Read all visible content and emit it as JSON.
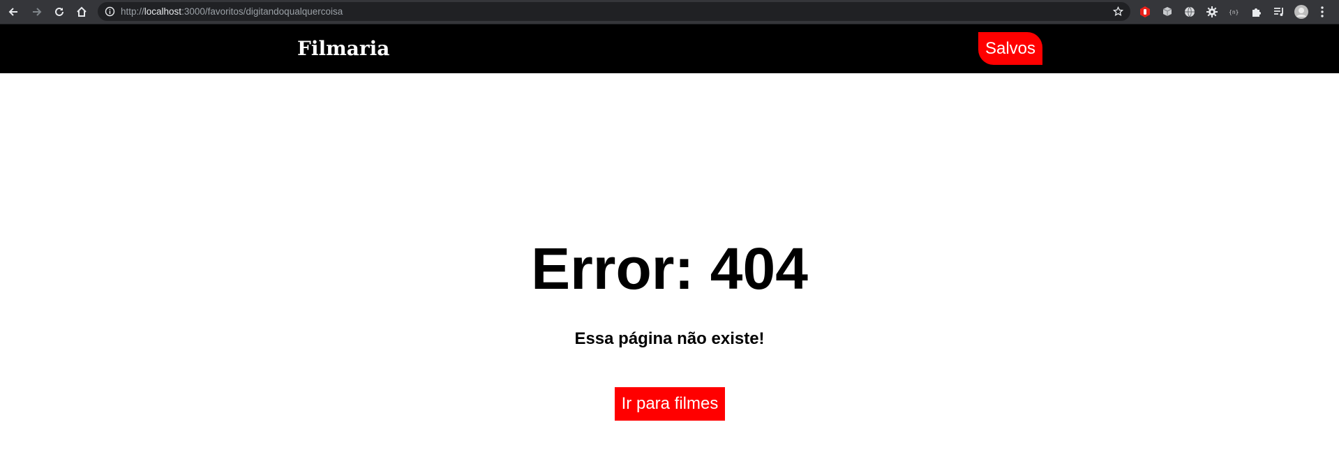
{
  "browser": {
    "url_prefix": "http://",
    "url_host": "localhost",
    "url_rest": ":3000/favoritos/digitandoqualquercoisa",
    "icons": [
      "back-icon",
      "forward-icon",
      "reload-icon",
      "home-icon",
      "info-icon",
      "star-icon",
      "extension-hand-icon",
      "extension-box-icon",
      "extension-globe-icon",
      "extension-gear-icon",
      "extension-code-icon",
      "puzzle-icon",
      "media-queue-icon",
      "profile-avatar-icon",
      "menu-dots-icon"
    ]
  },
  "header": {
    "logo": "Filmaria",
    "saved_label": "Salvos",
    "background": "#000000",
    "accent": "#ff0000"
  },
  "main": {
    "title": "Error: 404",
    "message": "Essa página não existe!",
    "button_label": "Ir para filmes"
  }
}
